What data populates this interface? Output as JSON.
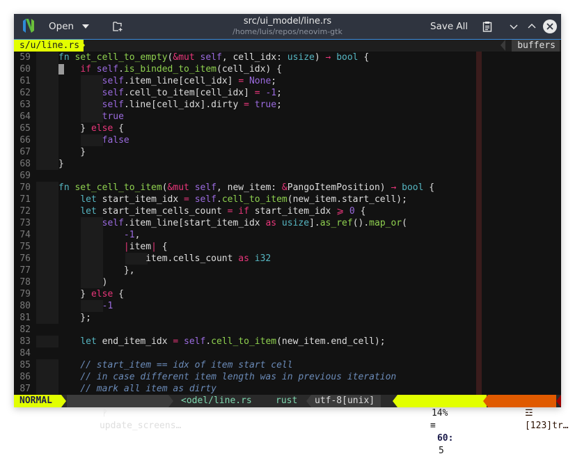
{
  "titlebar": {
    "open_label": "Open",
    "title": "src/ui_model/line.rs",
    "subtitle": "/home/luis/repos/neovim-gtk",
    "save_all_label": "Save All"
  },
  "tabline": {
    "current_tab": "s/u/line.rs",
    "buffers_label": "buffers"
  },
  "editor": {
    "lines": [
      {
        "n": "59",
        "g": [
          1
        ],
        "tokens": [
          [
            "fn",
            "fn"
          ],
          [
            "t",
            " "
          ],
          [
            "fname",
            "set_cell_to_empty"
          ],
          [
            "t",
            "("
          ],
          [
            "kw",
            "&mut"
          ],
          [
            "t",
            " "
          ],
          [
            "self",
            "self"
          ],
          [
            "t",
            ", cell_idx: "
          ],
          [
            "type",
            "usize"
          ],
          [
            "t",
            ") "
          ],
          [
            "kw",
            "→"
          ],
          [
            "t",
            " "
          ],
          [
            "type",
            "bool"
          ],
          [
            "t",
            " {"
          ]
        ]
      },
      {
        "n": "60",
        "g": [
          1
        ],
        "cursor": true,
        "tokens": [
          [
            "t",
            "    "
          ],
          [
            "kw",
            "if"
          ],
          [
            "t",
            " "
          ],
          [
            "self",
            "self"
          ],
          [
            "t",
            "."
          ],
          [
            "fname",
            "is_binded_to_item"
          ],
          [
            "t",
            "(cell_idx) {"
          ]
        ]
      },
      {
        "n": "61",
        "g": [
          1,
          2
        ],
        "tokens": [
          [
            "t",
            "        "
          ],
          [
            "self",
            "self"
          ],
          [
            "t",
            ".item_line[cell_idx] "
          ],
          [
            "kw",
            "="
          ],
          [
            "t",
            " "
          ],
          [
            "lit",
            "None"
          ],
          [
            "t",
            ";"
          ]
        ]
      },
      {
        "n": "62",
        "g": [
          1,
          2
        ],
        "tokens": [
          [
            "t",
            "        "
          ],
          [
            "self",
            "self"
          ],
          [
            "t",
            ".cell_to_item[cell_idx] "
          ],
          [
            "kw",
            "="
          ],
          [
            "t",
            " "
          ],
          [
            "lit",
            "-1"
          ],
          [
            "t",
            ";"
          ]
        ]
      },
      {
        "n": "63",
        "g": [
          1,
          2
        ],
        "tokens": [
          [
            "t",
            "        "
          ],
          [
            "self",
            "self"
          ],
          [
            "t",
            ".line[cell_idx].dirty "
          ],
          [
            "kw",
            "="
          ],
          [
            "t",
            " "
          ],
          [
            "lit",
            "true"
          ],
          [
            "t",
            ";"
          ]
        ]
      },
      {
        "n": "64",
        "g": [
          1,
          2
        ],
        "tokens": [
          [
            "t",
            "        "
          ],
          [
            "lit",
            "true"
          ]
        ]
      },
      {
        "n": "65",
        "g": [
          1
        ],
        "tokens": [
          [
            "t",
            "    } "
          ],
          [
            "kw",
            "else"
          ],
          [
            "t",
            " {"
          ]
        ]
      },
      {
        "n": "66",
        "g": [
          1,
          2
        ],
        "tokens": [
          [
            "t",
            "        "
          ],
          [
            "lit",
            "false"
          ]
        ]
      },
      {
        "n": "67",
        "g": [
          1
        ],
        "tokens": [
          [
            "t",
            "    }"
          ]
        ]
      },
      {
        "n": "68",
        "g": [
          1
        ],
        "tokens": [
          [
            "t",
            "}"
          ]
        ]
      },
      {
        "n": "69",
        "g": [],
        "tokens": []
      },
      {
        "n": "70",
        "g": [
          1
        ],
        "tokens": [
          [
            "fn",
            "fn"
          ],
          [
            "t",
            " "
          ],
          [
            "fname",
            "set_cell_to_item"
          ],
          [
            "t",
            "("
          ],
          [
            "kw",
            "&mut"
          ],
          [
            "t",
            " "
          ],
          [
            "self",
            "self"
          ],
          [
            "t",
            ", new_item: "
          ],
          [
            "kw",
            "&"
          ],
          [
            "t",
            "PangoItemPosition) "
          ],
          [
            "kw",
            "→"
          ],
          [
            "t",
            " "
          ],
          [
            "type",
            "bool"
          ],
          [
            "t",
            " {"
          ]
        ]
      },
      {
        "n": "71",
        "g": [
          1
        ],
        "tokens": [
          [
            "t",
            "    "
          ],
          [
            "fn",
            "let"
          ],
          [
            "t",
            " start_item_idx "
          ],
          [
            "kw",
            "="
          ],
          [
            "t",
            " "
          ],
          [
            "self",
            "self"
          ],
          [
            "t",
            "."
          ],
          [
            "fname",
            "cell_to_item"
          ],
          [
            "t",
            "(new_item.start_cell);"
          ]
        ]
      },
      {
        "n": "72",
        "g": [
          1
        ],
        "tokens": [
          [
            "t",
            "    "
          ],
          [
            "fn",
            "let"
          ],
          [
            "t",
            " start_item_cells_count "
          ],
          [
            "kw",
            "="
          ],
          [
            "t",
            " "
          ],
          [
            "kw",
            "if"
          ],
          [
            "t",
            " start_item_idx "
          ],
          [
            "kw",
            "⩾"
          ],
          [
            "t",
            " "
          ],
          [
            "lit",
            "0"
          ],
          [
            "t",
            " {"
          ]
        ]
      },
      {
        "n": "73",
        "g": [
          1,
          2
        ],
        "tokens": [
          [
            "t",
            "        "
          ],
          [
            "self",
            "self"
          ],
          [
            "t",
            ".item_line[start_item_idx "
          ],
          [
            "kw",
            "as"
          ],
          [
            "t",
            " "
          ],
          [
            "type",
            "usize"
          ],
          [
            "t",
            "]."
          ],
          [
            "fname",
            "as_ref"
          ],
          [
            "t",
            "()."
          ],
          [
            "fname",
            "map_or"
          ],
          [
            "t",
            "("
          ]
        ]
      },
      {
        "n": "74",
        "g": [
          1,
          2
        ],
        "tokens": [
          [
            "t",
            "            "
          ],
          [
            "lit",
            "-1"
          ],
          [
            "t",
            ","
          ]
        ]
      },
      {
        "n": "75",
        "g": [
          1,
          2
        ],
        "tokens": [
          [
            "t",
            "            "
          ],
          [
            "kw",
            "|"
          ],
          [
            "t",
            "item"
          ],
          [
            "kw",
            "|"
          ],
          [
            "t",
            " {"
          ]
        ]
      },
      {
        "n": "76",
        "g": [
          1,
          2,
          3
        ],
        "tokens": [
          [
            "t",
            "                item.cells_count "
          ],
          [
            "kw",
            "as"
          ],
          [
            "t",
            " "
          ],
          [
            "type",
            "i32"
          ]
        ]
      },
      {
        "n": "77",
        "g": [
          1,
          2
        ],
        "tokens": [
          [
            "t",
            "            },"
          ]
        ]
      },
      {
        "n": "78",
        "g": [
          1,
          2
        ],
        "tokens": [
          [
            "t",
            "        )"
          ]
        ]
      },
      {
        "n": "79",
        "g": [
          1
        ],
        "tokens": [
          [
            "t",
            "    } "
          ],
          [
            "kw",
            "else"
          ],
          [
            "t",
            " {"
          ]
        ]
      },
      {
        "n": "80",
        "g": [
          1,
          2
        ],
        "tokens": [
          [
            "t",
            "        "
          ],
          [
            "lit",
            "-1"
          ]
        ]
      },
      {
        "n": "81",
        "g": [
          1
        ],
        "tokens": [
          [
            "t",
            "    };"
          ]
        ]
      },
      {
        "n": "82",
        "g": [],
        "tokens": []
      },
      {
        "n": "83",
        "g": [
          1
        ],
        "tokens": [
          [
            "t",
            "    "
          ],
          [
            "fn",
            "let"
          ],
          [
            "t",
            " end_item_idx "
          ],
          [
            "kw",
            "="
          ],
          [
            "t",
            " "
          ],
          [
            "self",
            "self"
          ],
          [
            "t",
            "."
          ],
          [
            "fname",
            "cell_to_item"
          ],
          [
            "t",
            "(new_item.end_cell);"
          ]
        ]
      },
      {
        "n": "84",
        "g": [],
        "tokens": []
      },
      {
        "n": "85",
        "g": [
          1
        ],
        "tokens": [
          [
            "t",
            "    "
          ],
          [
            "cm",
            "// start_item == idx of item start cell"
          ]
        ]
      },
      {
        "n": "86",
        "g": [
          1
        ],
        "tokens": [
          [
            "t",
            "    "
          ],
          [
            "cm",
            "// in case different item length was in previous iteration"
          ]
        ]
      },
      {
        "n": "87",
        "g": [
          1
        ],
        "tokens": [
          [
            "t",
            "    "
          ],
          [
            "cm",
            "// mark all item as dirty"
          ]
        ]
      }
    ]
  },
  "statusline": {
    "mode": "NORMAL",
    "branch_icon": "git-branch-icon",
    "branch": "update_screens…",
    "file": "<odel/line.rs",
    "filetype": "rust",
    "encoding": "utf-8[unix]",
    "percent": "14%",
    "percent_icon": "≡",
    "line": "60",
    "col": "5",
    "trailing_icon": "☲",
    "trailing": "[123]tr…"
  },
  "colors": {
    "accent_yellow": "#e2ff00",
    "accent_orange": "#e05a00",
    "window_border": "#3d8ee0"
  }
}
